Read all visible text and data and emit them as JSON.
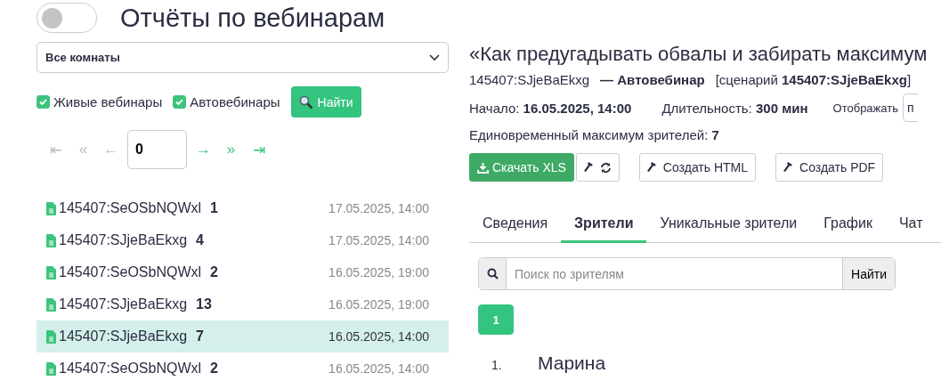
{
  "header": {
    "toggle": {
      "on": false
    },
    "title": "Отчёты по вебинарам"
  },
  "filters": {
    "room_select": {
      "value": "Все комнаты"
    },
    "checkboxes": [
      {
        "label": "Живые вебинары",
        "checked": true
      },
      {
        "label": "Автовебинары",
        "checked": true
      }
    ],
    "search_button": "Найти"
  },
  "pagination": {
    "buttons_before": [
      {
        "symbol": "⇤",
        "disabled": true
      },
      {
        "symbol": "«",
        "disabled": true
      },
      {
        "symbol": "←",
        "disabled": true
      }
    ],
    "page": "0",
    "buttons_after": [
      {
        "symbol": "→",
        "disabled": false
      },
      {
        "symbol": "»",
        "disabled": false
      },
      {
        "symbol": "⇥",
        "disabled": false
      }
    ]
  },
  "webinars": [
    {
      "name": "145407:SeOSbNQWxl",
      "count": "1",
      "date": "17.05.2025, 14:00",
      "selected": false
    },
    {
      "name": "145407:SJjeBaEkxg",
      "count": "4",
      "date": "17.05.2025, 14:00",
      "selected": false
    },
    {
      "name": "145407:SeOSbNQWxl",
      "count": "2",
      "date": "16.05.2025, 19:00",
      "selected": false
    },
    {
      "name": "145407:SJjeBaEkxg",
      "count": "13",
      "date": "16.05.2025, 19:00",
      "selected": false
    },
    {
      "name": "145407:SJjeBaEkxg",
      "count": "7",
      "date": "16.05.2025, 14:00",
      "selected": true
    },
    {
      "name": "145407:SeOSbNQWxl",
      "count": "2",
      "date": "16.05.2025, 14:00",
      "selected": false
    }
  ],
  "details": {
    "title": "«Как предугадывать обвалы и забирать максимум",
    "id": "145407:SJjeBaEkxg",
    "type": "— Автовебинар",
    "scenario": "[сценарий **145407:SJjeBaEkxg**]",
    "start": "Начало: **16.05.2025, 14:00**",
    "duration": "Длительность: **300 мин**",
    "display_label": "Отображать",
    "display_select": "п",
    "max_viewers": "Единовременный максимум зрителей: **7**",
    "actions": [
      {
        "kind": "download",
        "label": "Скачать XLS"
      },
      {
        "kind": "rebuild"
      },
      {
        "kind": "create",
        "label": "Создать HTML"
      },
      {
        "kind": "create",
        "label": "Создать PDF"
      }
    ],
    "tabs": [
      {
        "label": "Сведения",
        "selected": false
      },
      {
        "label": "Зрители",
        "selected": true
      },
      {
        "label": "Уникальные зрители",
        "selected": false
      },
      {
        "label": "График",
        "selected": false
      },
      {
        "label": "Чат",
        "selected": false
      }
    ],
    "viewer_search": {
      "placeholder": "Поиск по зрителям",
      "button": "Найти"
    },
    "pages": [
      {
        "label": "1",
        "selected": true
      }
    ],
    "viewers": [
      {
        "number": "1.",
        "name": "Марина"
      }
    ]
  }
}
